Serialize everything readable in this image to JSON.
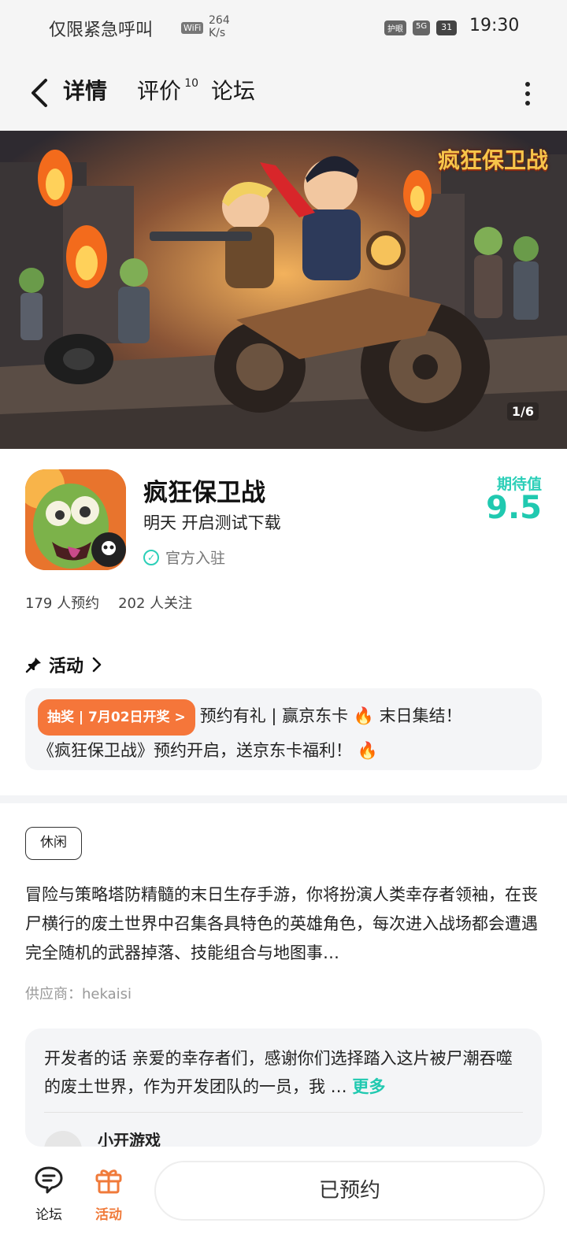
{
  "status_bar": {
    "carrier": "仅限紧急呼叫",
    "wifi": "WiFi",
    "speed_value": "264",
    "speed_unit": "K/s",
    "eye_mode": "护眼",
    "network": "5G",
    "battery": "31",
    "time": "19:30"
  },
  "header": {
    "tabs": [
      {
        "label": "详情",
        "active": true
      },
      {
        "label": "评价",
        "badge": "10"
      },
      {
        "label": "论坛"
      }
    ]
  },
  "banner": {
    "logo_text": "疯狂保卫战",
    "counter": "1/6"
  },
  "game": {
    "title": "疯狂保卫战",
    "status": "明天 开启测试下载",
    "official": "官方入驻",
    "expect_label": "期待值",
    "expect_value": "9.5",
    "reservations": "179 人预约",
    "followers": "202 人关注"
  },
  "activity": {
    "heading": "活动",
    "badge": "抽奖 | 7月02日开奖 >",
    "line1": "预约有礼 | 赢京东卡 🔥 末日集结！",
    "line2": "《疯狂保卫战》预约开启，送京东卡福利！ 🔥"
  },
  "description": {
    "tag": "休闲",
    "text": "冒险与策略塔防精髓的末日生存手游，你将扮演人类幸存者领袖，在丧尸横行的废土世界中召集各具特色的英雄角色，每次进入战场都会遭遇完全随机的武器掉落、技能组合与地图事…",
    "supplier": "供应商：hekaisi"
  },
  "developer": {
    "text": "开发者的话  亲爱的幸存者们，感谢你们选择踏入这片被尸潮吞噬的废土世界，作为开发团队的一员，我 …",
    "more": "更多",
    "name": "小开游戏"
  },
  "bottom_bar": {
    "forum": "论坛",
    "activity": "活动",
    "reserve_button": "已预约"
  }
}
